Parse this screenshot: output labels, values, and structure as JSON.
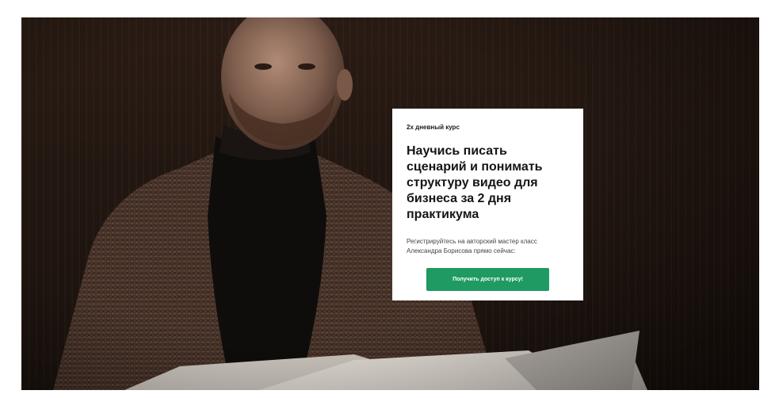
{
  "card": {
    "eyebrow": "2х дневный курс",
    "headline": "Научись писать сценарий и понимать структуру видео для бизнеса за 2 дня практикума",
    "description": "Регистрируйтесь на авторский мастер класс Александра Борисова прямо сейчас:",
    "cta_label": "Получить доступ к курсу!"
  },
  "colors": {
    "cta_background": "#1f9a63",
    "hero_background": "#231711",
    "card_background": "#ffffff"
  }
}
